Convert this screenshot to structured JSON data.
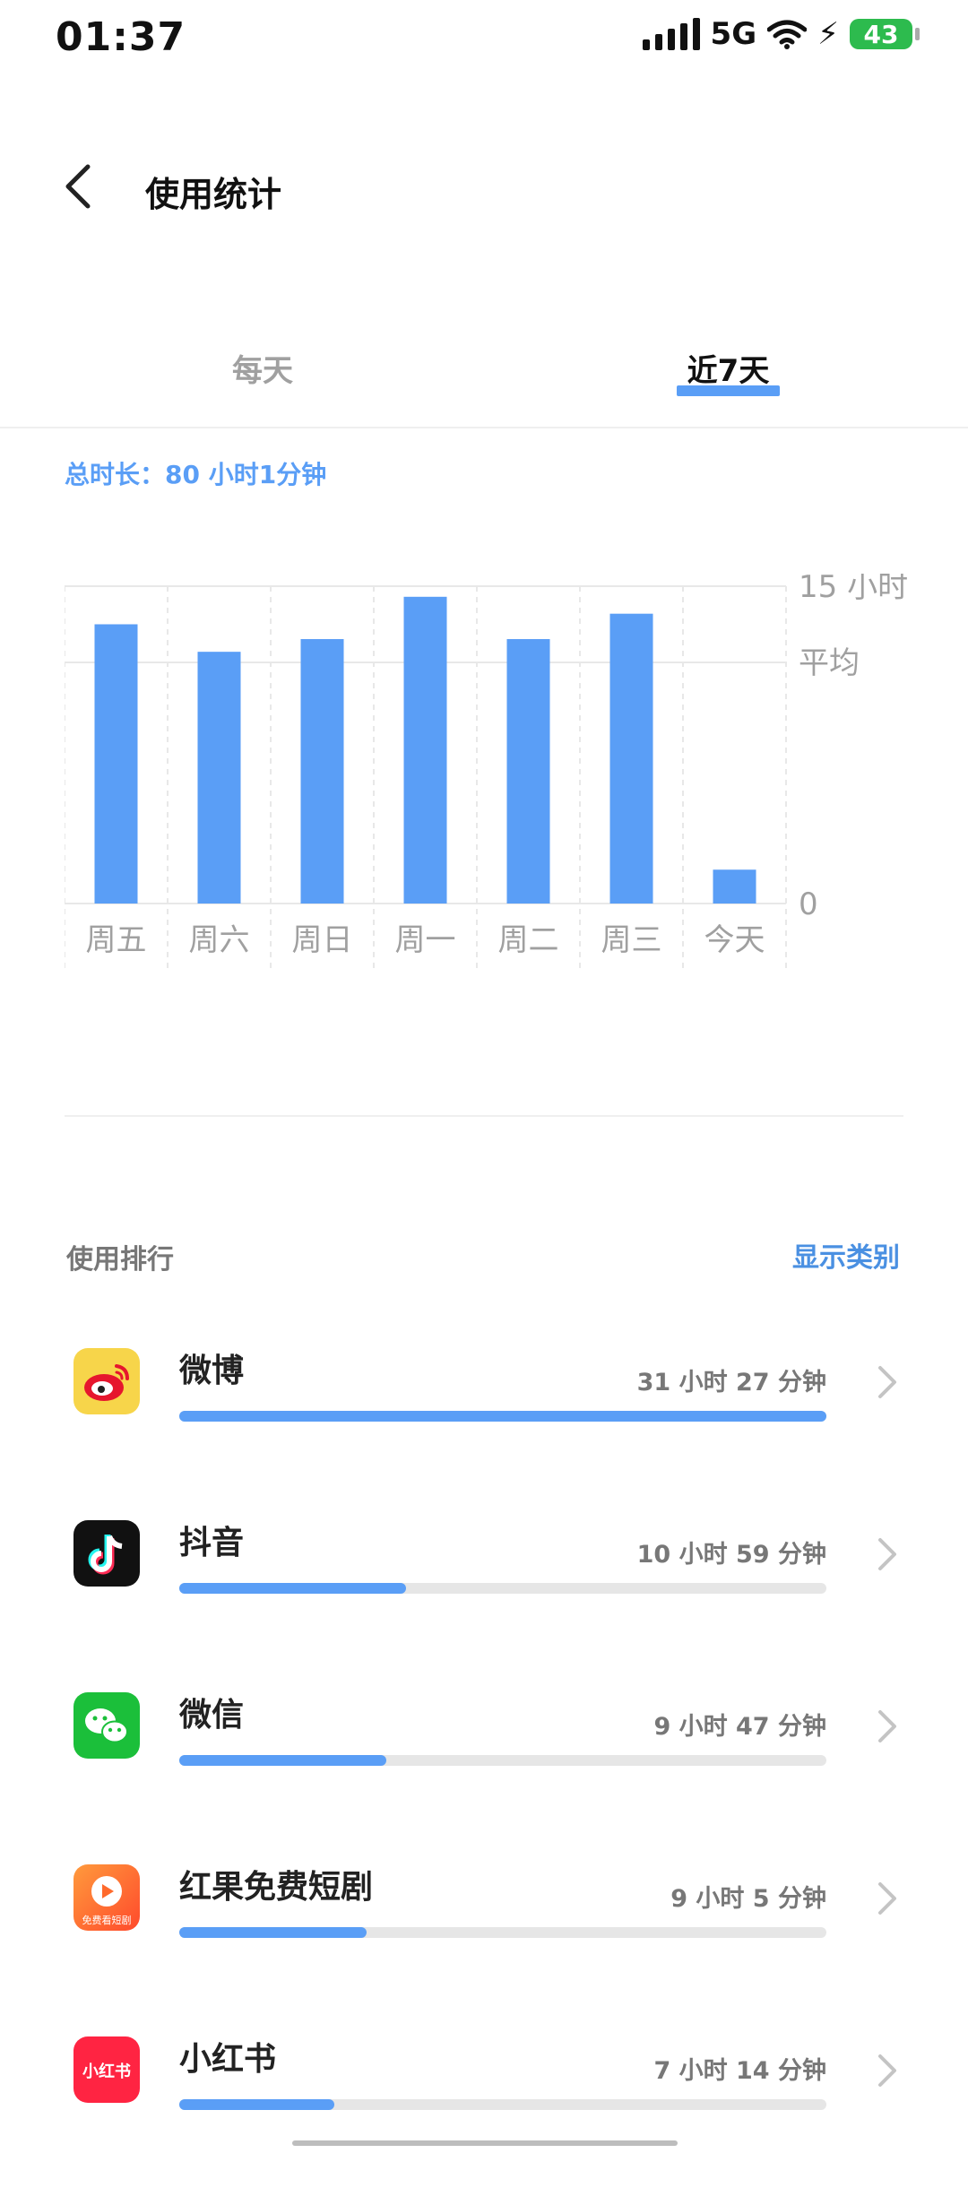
{
  "status": {
    "time": "01:37",
    "network": "5G",
    "battery": "43"
  },
  "header": {
    "title": "使用统计"
  },
  "tabs": [
    {
      "label": "每天",
      "active": false
    },
    {
      "label": "近7天",
      "active": true
    }
  ],
  "summary": {
    "total": "总时长：80 小时1分钟"
  },
  "chart_data": {
    "type": "bar",
    "categories": [
      "周五",
      "周六",
      "周日",
      "周一",
      "周二",
      "周三",
      "今天"
    ],
    "values": [
      13.2,
      11.9,
      12.5,
      14.5,
      12.5,
      13.7,
      1.6
    ],
    "ylim": [
      0,
      15
    ],
    "y_ticks": [
      {
        "label": "15 小时",
        "value": 15
      },
      {
        "label": "平均",
        "value": 11.4
      },
      {
        "label": "0",
        "value": 0
      }
    ],
    "bar_color": "#5a9ef6",
    "grid": true
  },
  "ranking": {
    "label": "使用排行",
    "link": "显示类别",
    "apps": [
      {
        "name": "微博",
        "time": "31 小时 27 分钟",
        "progress": 1.0,
        "icon": "weibo-icon"
      },
      {
        "name": "抖音",
        "time": "10 小时 59 分钟",
        "progress": 0.35,
        "icon": "douyin-icon"
      },
      {
        "name": "微信",
        "time": "9 小时 47 分钟",
        "progress": 0.32,
        "icon": "wechat-icon"
      },
      {
        "name": "红果免费短剧",
        "time": "9 小时 5 分钟",
        "progress": 0.29,
        "icon": "hongguo-icon"
      },
      {
        "name": "小红书",
        "time": "7 小时 14 分钟",
        "progress": 0.24,
        "icon": "xiaohongshu-icon"
      }
    ]
  },
  "icon_text": {
    "hongguo": "免费看短剧",
    "xiaohongshu": "小红书"
  },
  "colors": {
    "accent": "#5a9ef6",
    "link": "#4a90e2"
  }
}
